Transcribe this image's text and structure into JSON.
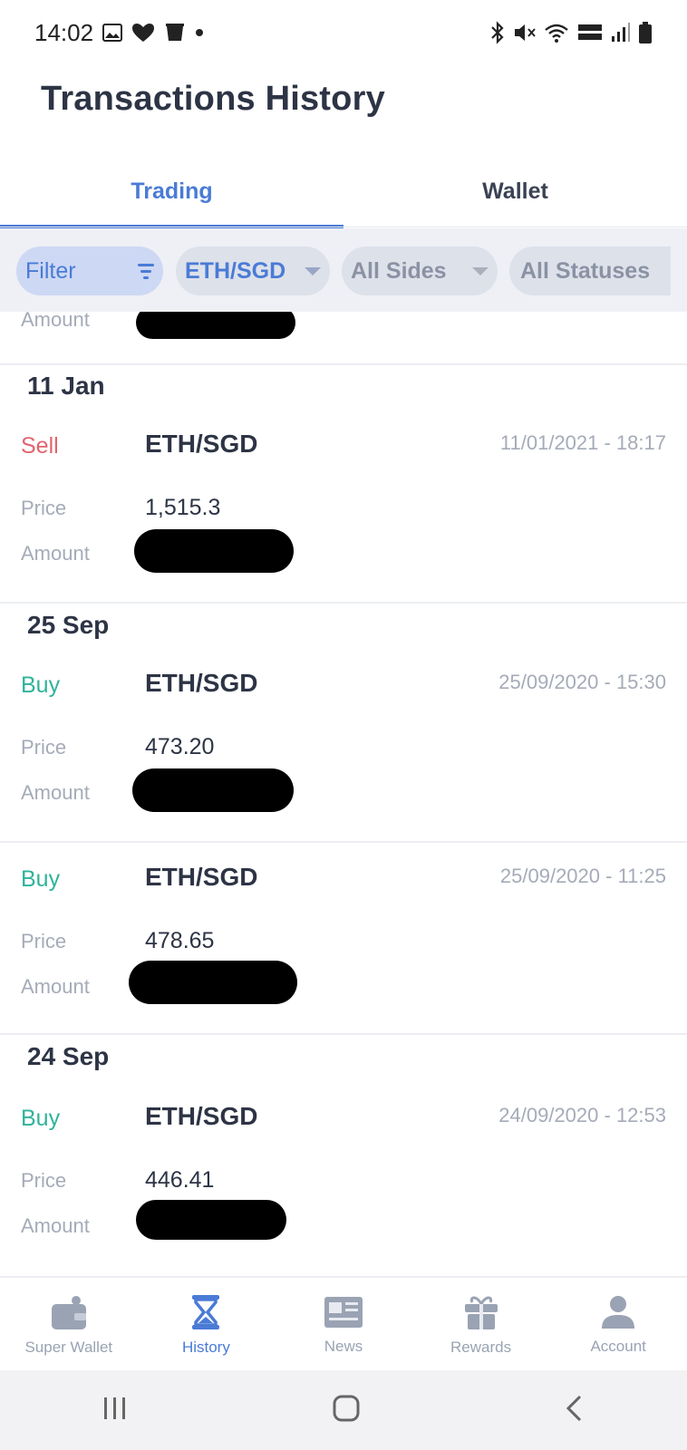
{
  "status_bar": {
    "time": "14:02"
  },
  "header": {
    "title": "Transactions History"
  },
  "tabs": [
    {
      "label": "Trading",
      "active": true
    },
    {
      "label": "Wallet",
      "active": false
    }
  ],
  "filters": {
    "filter_label": "Filter",
    "pair": "ETH/SGD",
    "sides": "All Sides",
    "statuses": "All Statuses"
  },
  "labels": {
    "price": "Price",
    "amount": "Amount"
  },
  "groups": [
    {
      "date": "11 Jan",
      "transactions": [
        {
          "side": "Sell",
          "pair": "ETH/SGD",
          "timestamp": "11/01/2021 - 18:17",
          "price": "1,515.3"
        }
      ]
    },
    {
      "date": "25 Sep",
      "transactions": [
        {
          "side": "Buy",
          "pair": "ETH/SGD",
          "timestamp": "25/09/2020 - 15:30",
          "price": "473.20"
        },
        {
          "side": "Buy",
          "pair": "ETH/SGD",
          "timestamp": "25/09/2020 - 11:25",
          "price": "478.65"
        }
      ]
    },
    {
      "date": "24 Sep",
      "transactions": [
        {
          "side": "Buy",
          "pair": "ETH/SGD",
          "timestamp": "24/09/2020 - 12:53",
          "price": "446.41"
        }
      ]
    }
  ],
  "bottom_nav": [
    {
      "label": "Super Wallet",
      "icon": "wallet-icon",
      "active": false
    },
    {
      "label": "History",
      "icon": "hourglass-icon",
      "active": true
    },
    {
      "label": "News",
      "icon": "newspaper-icon",
      "active": false
    },
    {
      "label": "Rewards",
      "icon": "gift-icon",
      "active": false
    },
    {
      "label": "Account",
      "icon": "person-icon",
      "active": false
    }
  ],
  "colors": {
    "accent": "#4a7bd6",
    "sell": "#e2646e",
    "buy": "#2fb39b",
    "muted": "#a5abb8"
  }
}
